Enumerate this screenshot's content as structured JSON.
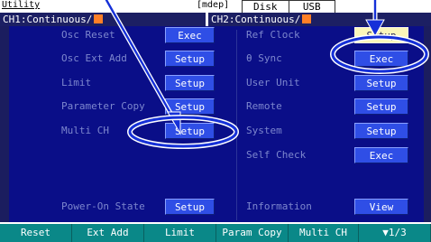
{
  "header": {
    "menu_title": "Utility",
    "mode_text": "[mdep]",
    "drive_buttons": [
      "Disk",
      "USB"
    ]
  },
  "channels": {
    "ch1_label": "CH1:Continuous/",
    "ch2_label": "CH2:Continuous/"
  },
  "left_column": [
    {
      "label": "Osc Reset",
      "button": "Exec"
    },
    {
      "label": "Osc Ext Add",
      "button": "Setup"
    },
    {
      "label": "Limit",
      "button": "Setup"
    },
    {
      "label": "Parameter Copy",
      "button": "Setup"
    },
    {
      "label": "Multi CH",
      "button": "Setup"
    },
    {
      "label": "Power-On State",
      "button": "Setup"
    }
  ],
  "right_column": [
    {
      "label": "Ref Clock",
      "button": "Setup",
      "selected": true
    },
    {
      "label": "θ Sync",
      "button": "Exec"
    },
    {
      "label": "User Unit",
      "button": "Setup"
    },
    {
      "label": "Remote",
      "button": "Setup"
    },
    {
      "label": "System",
      "button": "Setup"
    },
    {
      "label": "Self Check",
      "button": "Exec"
    },
    {
      "label": "Information",
      "button": "View"
    }
  ],
  "softkeys": [
    "Reset",
    "Ext Add",
    "Limit",
    "Param Copy",
    "Multi CH",
    "▼1/3"
  ],
  "colors": {
    "panel": "#0a0e88",
    "button": "#2f4ee6",
    "selected_button": "#fbf6b9",
    "softkey": "#0a8888",
    "channel_indicator": "#ff7f27",
    "callout": "#1530d8"
  }
}
